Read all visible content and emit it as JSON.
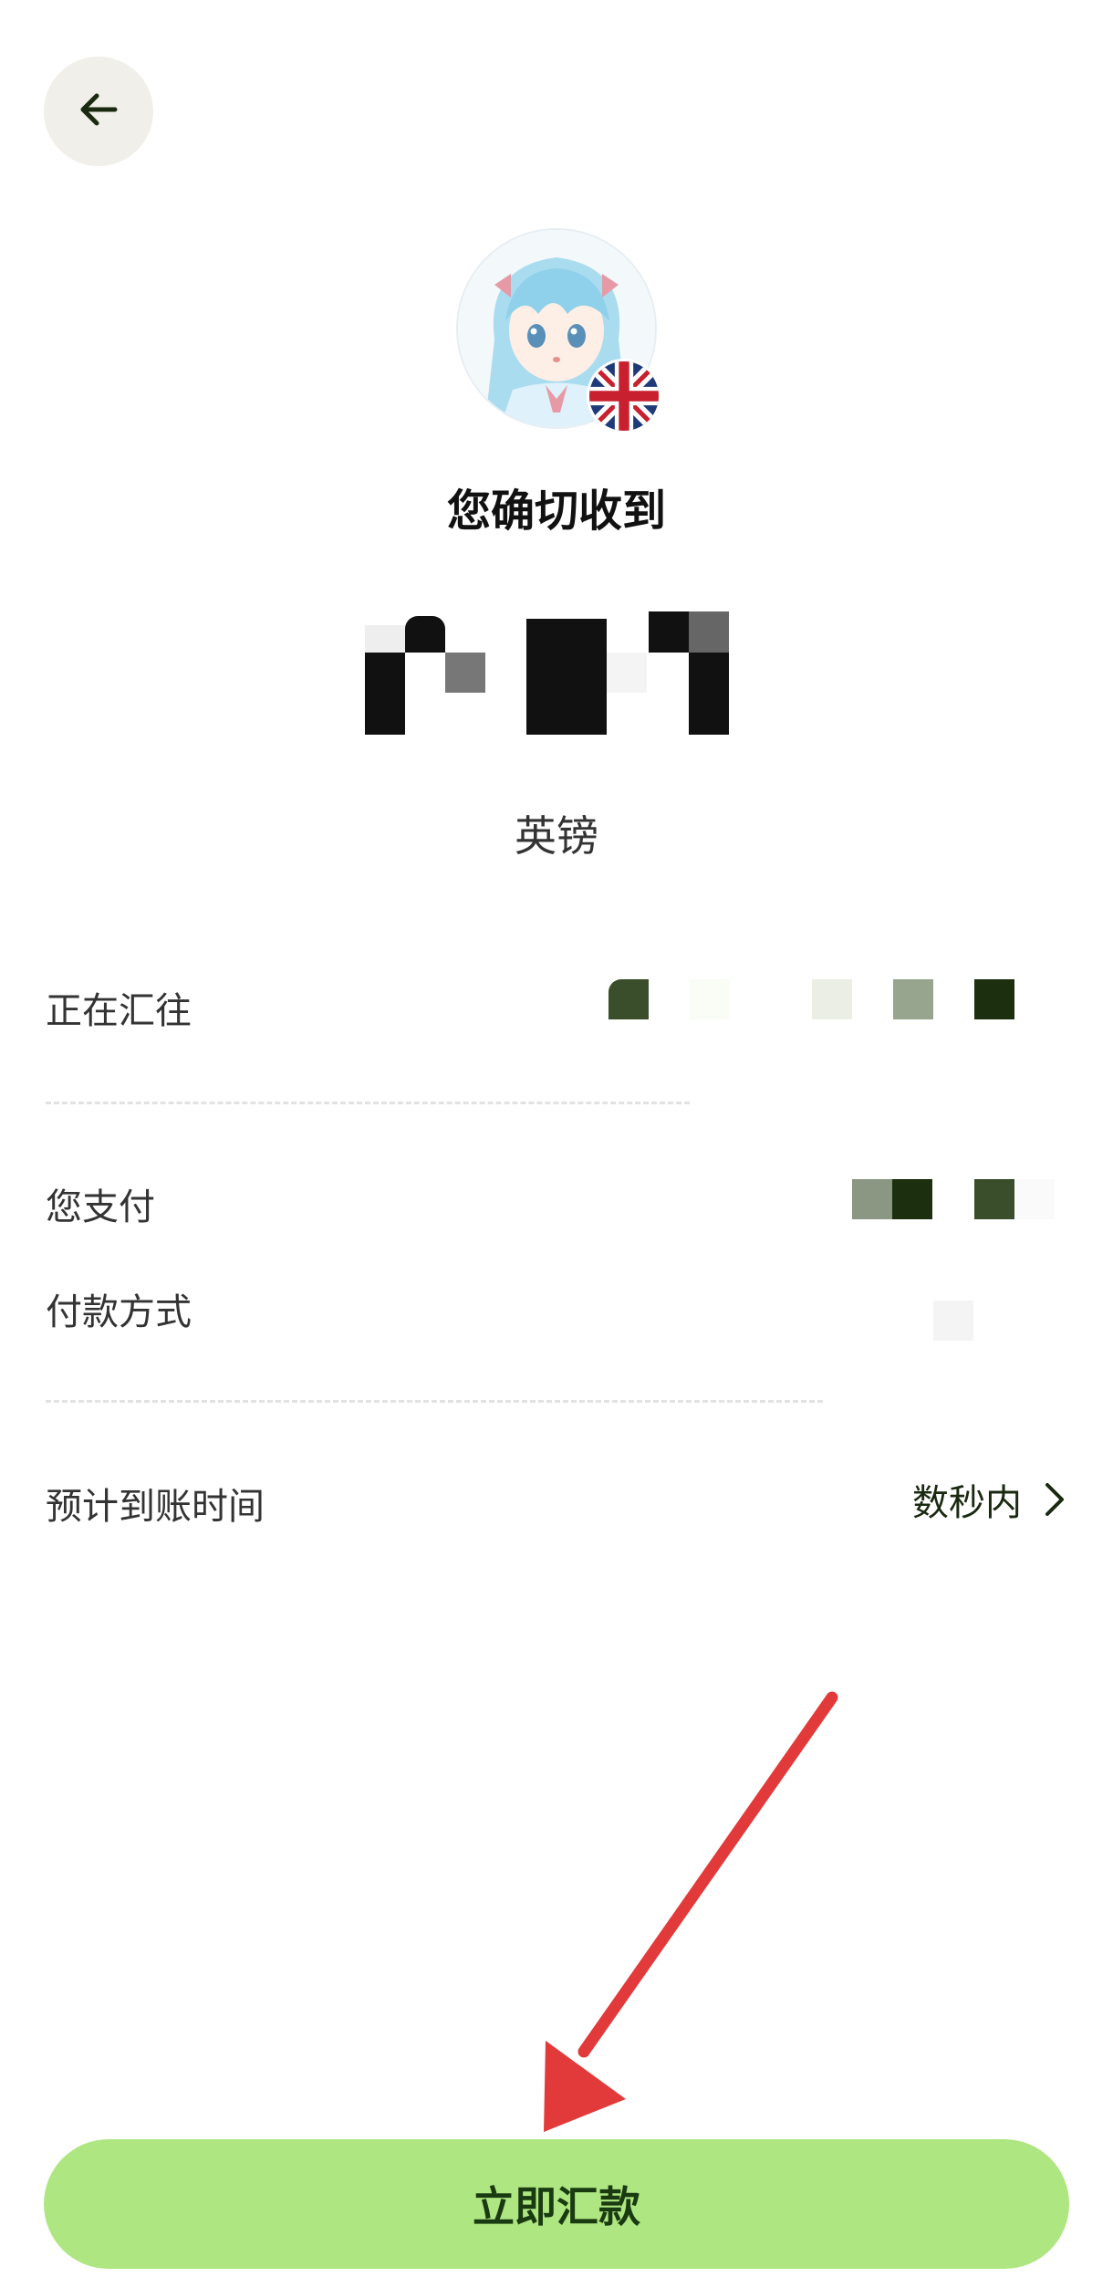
{
  "header": {
    "back_icon": "arrow-left-icon"
  },
  "recipient": {
    "avatar_icon": "anime-avatar",
    "flag_icon": "uk-flag-icon",
    "title": "您确切收到",
    "currency": "英镑"
  },
  "details": {
    "sending_to_label": "正在汇往",
    "you_pay_label": "您支付",
    "payment_method_label": "付款方式",
    "eta_label": "预计到账时间",
    "eta_value": "数秒内",
    "eta_chevron_icon": "chevron-right-icon"
  },
  "cta": {
    "label": "立即汇款"
  },
  "colors": {
    "accent": "#aee681",
    "annotation_arrow": "#e23a3a"
  }
}
